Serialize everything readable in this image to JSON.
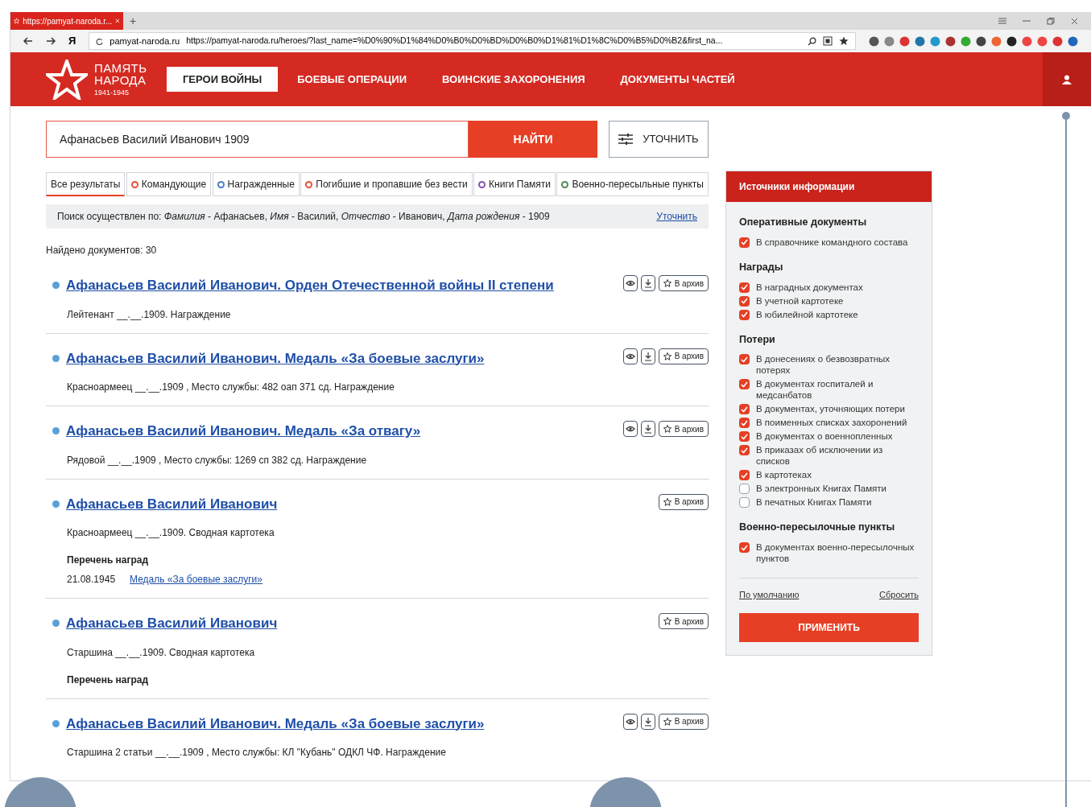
{
  "browser": {
    "tab_title": "https://pamyat-naroda.r...",
    "new_tab": "+",
    "yandex": "Я",
    "domain": "pamyat-naroda.ru",
    "url": "https://pamyat-naroda.ru/heroes/?last_name=%D0%90%D1%84%D0%B0%D0%BD%D0%B0%D1%81%D1%8C%D0%B5%D0%B2&first_na..."
  },
  "logo": {
    "line_1": "ПАМЯТЬ",
    "line_2": "НАРОДА",
    "years": "1941-1945"
  },
  "nav": [
    {
      "label": "ГЕРОИ ВОЙНЫ",
      "selected": true
    },
    {
      "label": "БОЕВЫЕ ОПЕРАЦИИ",
      "selected": false
    },
    {
      "label": "ВОИНСКИЕ ЗАХОРОНЕНИЯ",
      "selected": false
    },
    {
      "label": "ДОКУМЕНТЫ ЧАСТЕЙ",
      "selected": false
    }
  ],
  "search": {
    "value": "Афанасьев Василий Иванович 1909",
    "button": "НАЙТИ",
    "refine_button": "УТОЧНИТЬ"
  },
  "filters": [
    {
      "label": "Все результаты",
      "selected": true
    },
    {
      "label": "Командующие",
      "selected": false,
      "color": "#e8503a"
    },
    {
      "label": "Награжденные",
      "selected": false,
      "color": "#4a7fc1"
    },
    {
      "label": "Погибшие и пропавшие без вести",
      "selected": false,
      "color": "#e8503a"
    },
    {
      "label": "Книги Памяти",
      "selected": false,
      "color": "#8a4fb0"
    },
    {
      "label": "Военно-пересыльные пункты",
      "selected": false,
      "color": "#4f8a4f"
    }
  ],
  "summary": {
    "text": "Поиск осуществлен по: *Фамилия* - Афанасьев, *Имя* - Василий, *Отчество* - Иванович, *Дата рождения* - 1909",
    "link": "Уточнить"
  },
  "found": "Найдено документов: 30",
  "results": [
    {
      "title": "Афанасьев Василий Иванович. Орден Отечественной войны II степени",
      "subtitle": "Лейтенант __.__.1909. Награждение",
      "view": true,
      "download": true,
      "archive": "В архив"
    },
    {
      "title": "Афанасьев Василий Иванович. Медаль «За боевые заслуги»",
      "subtitle": "Красноармеец __.__.1909 , Место службы: 482 оап 371 сд. Награждение",
      "view": true,
      "download": true,
      "archive": "В архив"
    },
    {
      "title": "Афанасьев Василий Иванович. Медаль «За отвагу»",
      "subtitle": "Рядовой __.__.1909 , Место службы: 1269 сп 382 сд. Награждение",
      "view": true,
      "download": true,
      "archive": "В архив"
    },
    {
      "title": "Афанасьев Василий Иванович",
      "subtitle": "Красноармеец __.__.1909. Сводная картотека",
      "awards_heading": "Перечень наград",
      "awards": [
        {
          "date": "21.08.1945",
          "name": "Медаль «За боевые заслуги»"
        }
      ],
      "archive": "В архив"
    },
    {
      "title": "Афанасьев Василий Иванович",
      "subtitle": "Старшина __.__.1909. Сводная картотека",
      "awards_heading": "Перечень наград",
      "archive": "В архив"
    },
    {
      "title": "Афанасьев Василий Иванович. Медаль «За боевые заслуги»",
      "subtitle": "Старшина 2 статьи __.__.1909 , Место службы: КЛ \"Кубань\" ОДКЛ ЧФ. Награждение",
      "view": true,
      "download": true,
      "archive": "В архив"
    }
  ],
  "sources": {
    "title": "Источники информации",
    "groups": [
      {
        "heading": "Оперативные документы",
        "items": [
          {
            "label": "В справочнике командного состава",
            "checked": true
          }
        ]
      },
      {
        "heading": "Награды",
        "items": [
          {
            "label": "В наградных документах",
            "checked": true
          },
          {
            "label": "В учетной картотеке",
            "checked": true
          },
          {
            "label": "В юбилейной картотеке",
            "checked": true
          }
        ]
      },
      {
        "heading": "Потери",
        "items": [
          {
            "label": "В донесениях о безвозвратных потерях",
            "checked": true
          },
          {
            "label": "В документах госпиталей и медсанбатов",
            "checked": true
          },
          {
            "label": "В документах, уточняющих потери",
            "checked": true
          },
          {
            "label": "В поименных списках захоронений",
            "checked": true
          },
          {
            "label": "В документах о военнопленных",
            "checked": true
          },
          {
            "label": "В приказах об исключении из списков",
            "checked": true
          },
          {
            "label": "В картотеках",
            "checked": true
          },
          {
            "label": "В электронных Книгах Памяти",
            "checked": false
          },
          {
            "label": "В печатных Книгах Памяти",
            "checked": false
          }
        ]
      },
      {
        "heading": "Военно-пересылочные пункты",
        "items": [
          {
            "label": "В документах военно-пересылочных пунктов",
            "checked": true
          }
        ]
      }
    ],
    "default_link": "По умолчанию",
    "reset_link": "Сбросить",
    "apply": "ПРИМЕНИТЬ"
  }
}
